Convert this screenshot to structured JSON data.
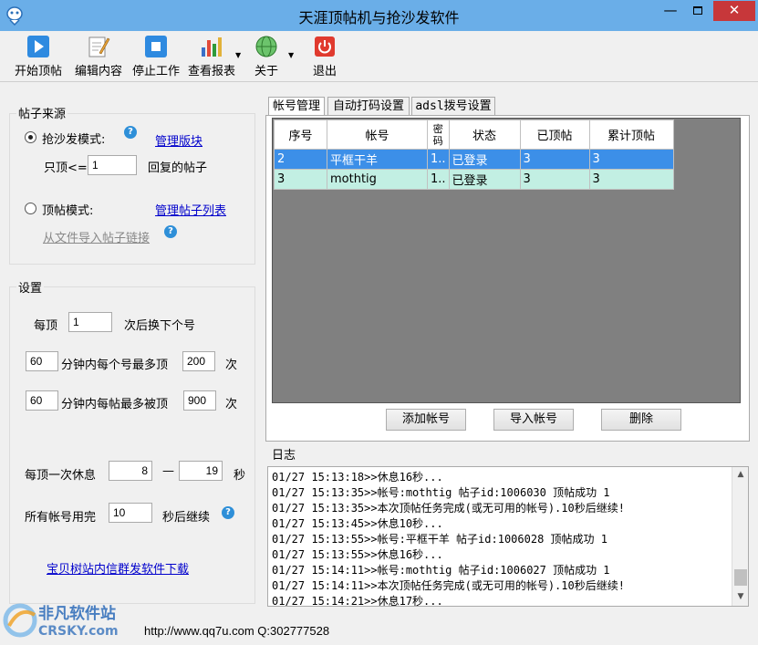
{
  "window": {
    "title": "天涯顶帖机与抢沙发软件",
    "min": "—",
    "close": "✕"
  },
  "toolbar": {
    "start": "开始顶帖",
    "edit": "编辑内容",
    "stop": "停止工作",
    "report": "查看报表",
    "about": "关于",
    "exit": "退出"
  },
  "source": {
    "title": "帖子来源",
    "sofa_mode": "抢沙发模式:",
    "manage_board": "管理版块",
    "only_top_prefix": "只顶<=",
    "only_top_value": "1",
    "only_top_suffix": "回复的帖子",
    "top_mode": "顶帖模式:",
    "manage_list": "管理帖子列表",
    "import_file": "从文件导入帖子链接"
  },
  "settings": {
    "title": "设置",
    "each_top_prefix": "每顶",
    "each_top_value": "1",
    "each_top_suffix": "次后换下个号",
    "min1_value": "60",
    "per_account_label": "分钟内每个号最多顶",
    "per_account_value": "200",
    "times1": "次",
    "min2_value": "60",
    "per_post_label": "分钟内每帖最多被顶",
    "per_post_value": "900",
    "times2": "次",
    "rest_label": "每顶一次休息",
    "rest_min": "8",
    "dash": "—",
    "rest_max": "19",
    "sec": "秒",
    "all_used_label": "所有帐号用完",
    "all_used_value": "10",
    "continue_label": "秒后继续",
    "download_link": "宝贝树站内信群发软件下载"
  },
  "tabs": [
    "帐号管理",
    "自动打码设置",
    "adsl拨号设置"
  ],
  "accounts": {
    "headers": [
      "序号",
      "帐号",
      "密码",
      "状态",
      "已顶帖",
      "累计顶帖"
    ],
    "rows": [
      {
        "id": "2",
        "account": "平框干羊",
        "pwd": "1..",
        "status": "已登录",
        "done": "3",
        "total": "3"
      },
      {
        "id": "3",
        "account": "mothtig",
        "pwd": "1..",
        "status": "已登录",
        "done": "3",
        "total": "3"
      }
    ],
    "add": "添加帐号",
    "import": "导入帐号",
    "delete": "删除"
  },
  "log": {
    "title": "日志",
    "lines": [
      "01/27 15:13:18>>休息16秒...",
      "01/27 15:13:35>>帐号:mothtig 帖子id:1006030 顶帖成功 1",
      "01/27 15:13:35>>本次顶帖任务完成(或无可用的帐号).10秒后继续!",
      "01/27 15:13:45>>休息10秒...",
      "01/27 15:13:55>>帐号:平框干羊 帖子id:1006028 顶帖成功 1",
      "01/27 15:13:55>>休息16秒...",
      "01/27 15:14:11>>帐号:mothtig 帖子id:1006027 顶帖成功 1",
      "01/27 15:14:11>>本次顶帖任务完成(或无可用的帐号).10秒后继续!",
      "01/27 15:14:21>>休息17秒..."
    ]
  },
  "status": {
    "text": "http://www.qq7u.com Q:302777528"
  },
  "watermark": {
    "line1": "非凡软件站",
    "line2": "CRSKY.com"
  }
}
